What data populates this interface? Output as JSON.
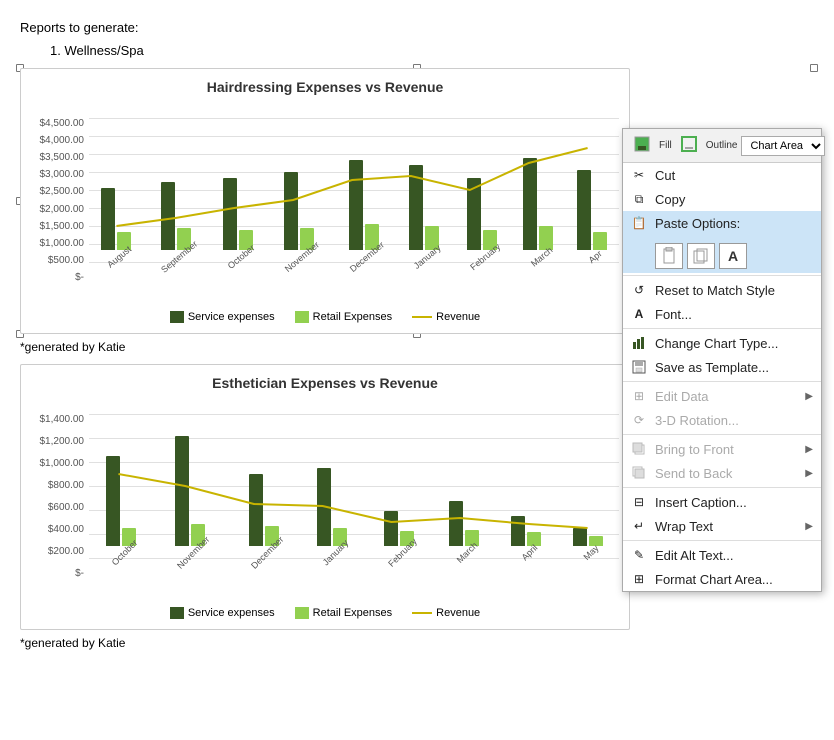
{
  "page": {
    "reports_label": "Reports to generate:",
    "wellness_item": "1.    Wellness/Spa",
    "generated_by": "*generated by Katie"
  },
  "chart1": {
    "title": "Hairdressing Expenses vs Revenue",
    "y_labels": [
      "$4,500.00",
      "$4,000.00",
      "$3,500.00",
      "$3,000.00",
      "$2,500.00",
      "$2,000.00",
      "$1,500.00",
      "$1,000.00",
      "$500.00",
      "$-"
    ],
    "x_labels": [
      "August",
      "September",
      "October",
      "November",
      "December",
      "January",
      "February",
      "March",
      "Apr"
    ],
    "bars_service": [
      62,
      60,
      65,
      70,
      85,
      82,
      70,
      88,
      78
    ],
    "bars_retail": [
      20,
      25,
      20,
      22,
      28,
      28,
      24,
      26,
      20
    ],
    "line_points": "8,55 68,58 128,62 188,56 248,38 308,40 368,50 428,30 488,22",
    "legend": {
      "service": "Service expenses",
      "retail": "Retail Expenses",
      "revenue": "Revenue"
    }
  },
  "chart2": {
    "title": "Esthetician Expenses vs Revenue",
    "y_labels": [
      "$1,400.00",
      "$1,200.00",
      "$1,000.00",
      "$800.00",
      "$600.00",
      "$400.00",
      "$200.00",
      "$-"
    ],
    "x_labels": [
      "October",
      "November",
      "December",
      "January",
      "February",
      "March",
      "April",
      "May"
    ],
    "bars_service": [
      78,
      95,
      70,
      75,
      38,
      48,
      32,
      20
    ],
    "bars_retail": [
      22,
      28,
      25,
      22,
      18,
      20,
      16,
      12
    ],
    "line_points": "8,35 78,45 148,68 218,70 288,90 358,88 428,92 498,95",
    "legend": {
      "service": "Service expenses",
      "retail": "Retail Expenses",
      "revenue": "Revenue"
    }
  },
  "context_menu": {
    "chart_area_label": "Chart Area",
    "fill_label": "Fill",
    "outline_label": "Outline",
    "cut_label": "Cut",
    "copy_label": "Copy",
    "paste_options_label": "Paste Options:",
    "reset_label": "Reset to Match Style",
    "font_label": "Font...",
    "change_chart_label": "Change Chart Type...",
    "save_template_label": "Save as Template...",
    "edit_data_label": "Edit Data",
    "rotation_label": "3-D Rotation...",
    "bring_to_front_label": "Bring to Front",
    "send_to_back_label": "Send to Back",
    "insert_caption_label": "Insert Caption...",
    "wrap_text_label": "Wrap Text",
    "edit_alt_label": "Edit Alt Text...",
    "format_chart_label": "Format Chart Area..."
  }
}
